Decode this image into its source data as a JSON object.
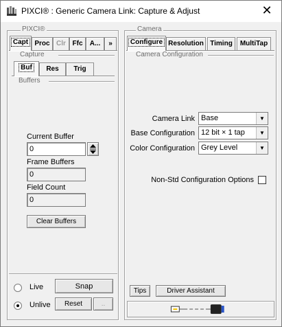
{
  "window": {
    "title": "PIXCI® : Generic Camera Link: Capture & Adjust",
    "close_glyph": "✕"
  },
  "left": {
    "group_label": "PIXCI®",
    "tabs": [
      {
        "label": "Capt",
        "active": true,
        "disabled": false
      },
      {
        "label": "Proc",
        "active": false,
        "disabled": false
      },
      {
        "label": "Clr",
        "active": false,
        "disabled": true
      },
      {
        "label": "Ffc",
        "active": false,
        "disabled": false
      },
      {
        "label": "A...",
        "active": false,
        "disabled": false
      },
      {
        "label": "»",
        "active": false,
        "disabled": false
      }
    ],
    "capture_label": "Capture",
    "subtabs": [
      {
        "label": "Buf",
        "active": true
      },
      {
        "label": "Res",
        "active": false
      },
      {
        "label": "Trig",
        "active": false
      }
    ],
    "buffers_label": "Buffers",
    "current_buffer_label": "Current Buffer",
    "current_buffer_value": "0",
    "frame_buffers_label": "Frame Buffers",
    "frame_buffers_value": "0",
    "field_count_label": "Field Count",
    "field_count_value": "0",
    "clear_buffers": "Clear Buffers",
    "live_label": "Live",
    "unlive_label": "Unlive",
    "unlive_selected": true,
    "snap": "Snap",
    "reset": "Reset",
    "extra_btn": ".."
  },
  "right": {
    "group_label": "Camera",
    "tabs": [
      {
        "label": "Configure",
        "active": true
      },
      {
        "label": "Resolution",
        "active": false
      },
      {
        "label": "Timing",
        "active": false
      },
      {
        "label": "MultiTap",
        "active": false
      }
    ],
    "config_label": "Camera Configuration",
    "camera_link_label": "Camera Link",
    "camera_link_value": "Base",
    "base_config_label": "Base Configuration",
    "base_config_value": "12 bit × 1 tap",
    "color_config_label": "Color Configuration",
    "color_config_value": "Grey Level",
    "nonstd_label": "Non-Std Configuration Options",
    "nonstd_checked": false,
    "tips": "Tips",
    "driver_assistant": "Driver Assistant"
  },
  "colors": {
    "accent_blue": "#2a55c8",
    "cable_dark": "#222222"
  }
}
